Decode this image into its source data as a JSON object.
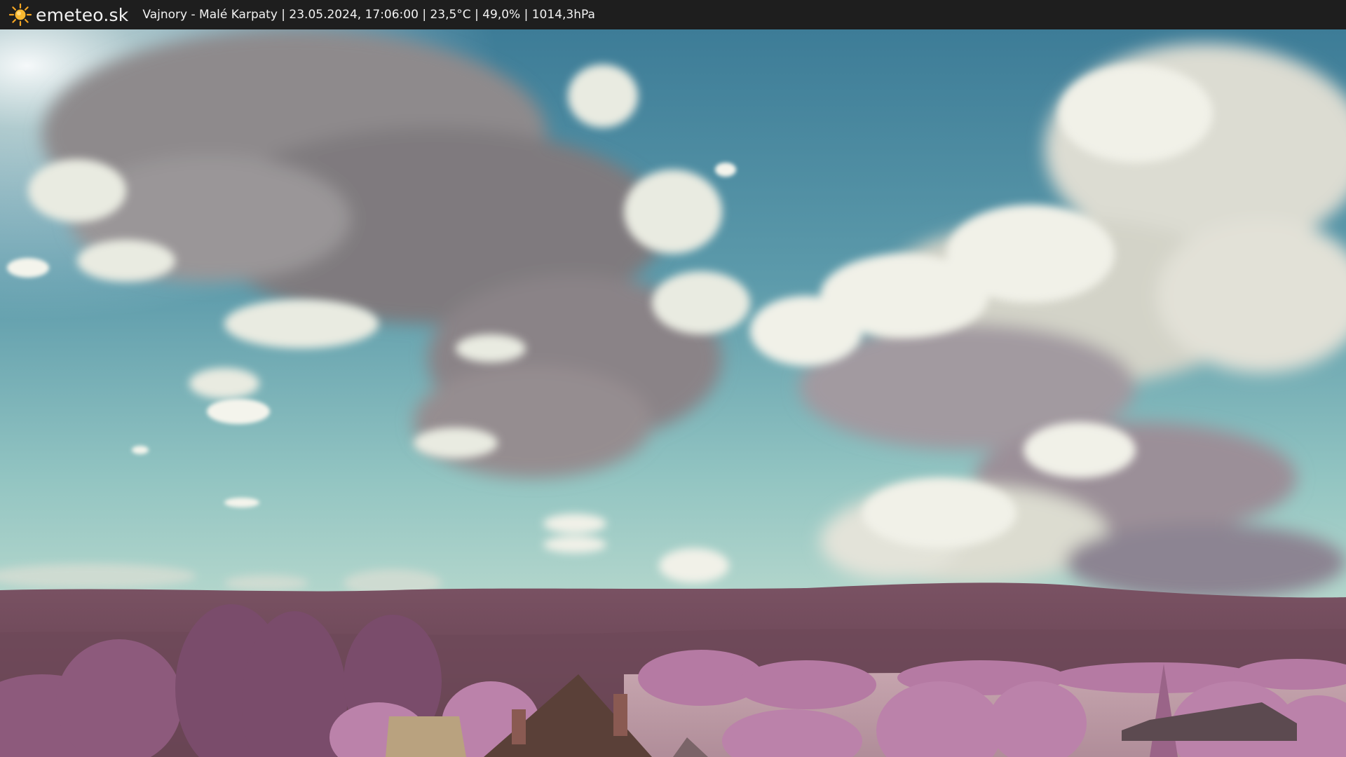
{
  "header": {
    "brand": "emeteo.sk",
    "logo_icon": "sun-icon",
    "caption": "Vajnory - Malé Karpaty | 23.05.2024, 17:06:00 | 23,5°C | 49,0% | 1014,3hPa"
  },
  "colors": {
    "bar_background": "#1e1e1e",
    "bar_text": "#f2f2f2",
    "logo_sun": "#f5a623",
    "sky_top": "#3f7f98",
    "sky_horizon": "#a9d2ca",
    "hills": "#6b4656",
    "foliage": "#b77aa5",
    "field": "#c9aab3",
    "roof": "#5a4038"
  }
}
